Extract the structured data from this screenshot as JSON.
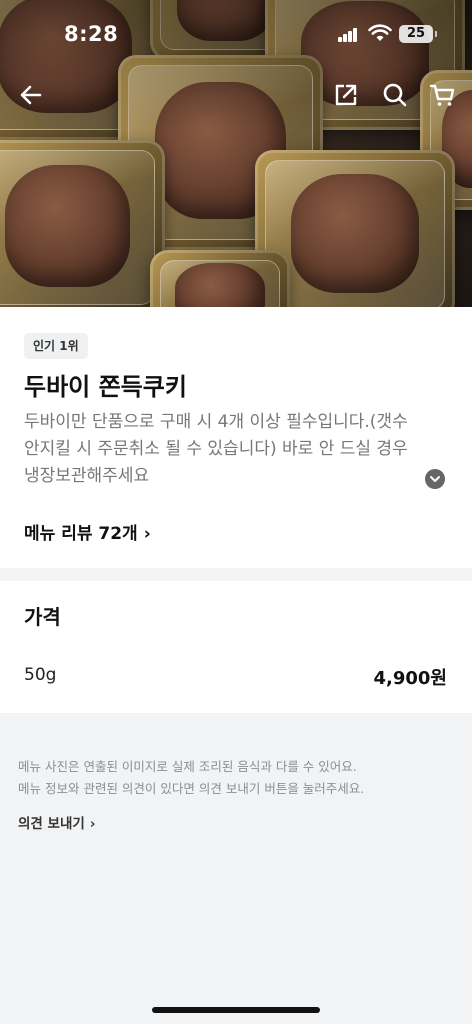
{
  "status_bar": {
    "time": "8:28",
    "battery": "25"
  },
  "badge": "인기 1위",
  "product": {
    "title": "두바이 쫀득쿠키",
    "description": "두바이만 단품으로 구매 시 4개 이상 필수입니다.(갯수 안지킬 시 주문취소 될 수 있습니다) 바로 안 드실 경우 냉장보관해주세요",
    "review_link": "메뉴 리뷰 72개"
  },
  "price_section": {
    "title": "가격",
    "options": [
      {
        "name": "50g",
        "price": "4,900원"
      }
    ]
  },
  "notice": {
    "line1": "메뉴 사진은 연출된 이미지로 실제 조리된 음식과 다를 수 있어요.",
    "line2": "메뉴 정보와 관련된 의견이 있다면 의견 보내기 버튼을 눌러주세요.",
    "feedback_link": "의견 보내기"
  },
  "icons": {
    "back": "back-arrow-icon",
    "share": "share-icon",
    "search": "search-icon",
    "cart": "cart-icon",
    "expand": "chevron-down-icon"
  }
}
